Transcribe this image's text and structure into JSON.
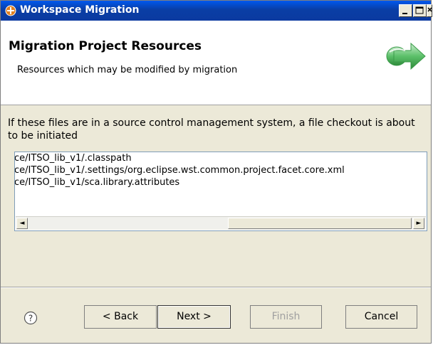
{
  "window": {
    "title": "Workspace Migration"
  },
  "header": {
    "title": "Migration Project Resources",
    "description": "Resources which may be modified by migration"
  },
  "message": "If these files are in a source control management system, a file checkout is about to be initiated",
  "files": [
    "ce/ITSO_lib_v1/.classpath",
    "ce/ITSO_lib_v1/.settings/org.eclipse.wst.common.project.facet.core.xml",
    "ce/ITSO_lib_v1/sca.library.attributes"
  ],
  "buttons": {
    "back": "< Back",
    "next": "Next >",
    "finish": "Finish",
    "cancel": "Cancel"
  },
  "scrollbar": {
    "left_arrow": "◄",
    "right_arrow": "►"
  },
  "colors": {
    "title_bar": "#0a3ea5",
    "arrow_icon": "#4caf50"
  }
}
